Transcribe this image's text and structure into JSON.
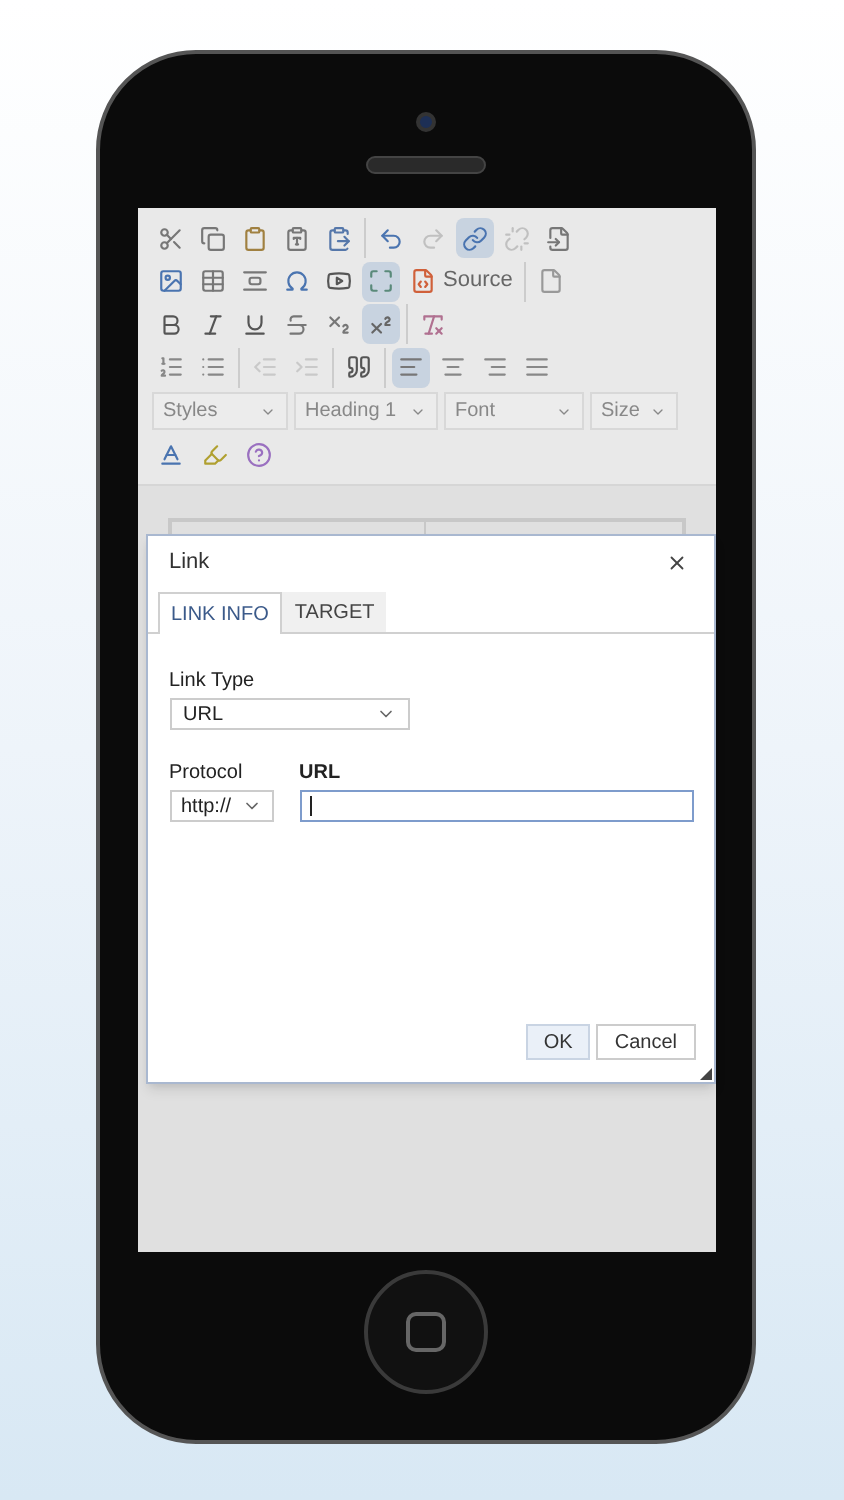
{
  "toolbar": {
    "rows": [
      {
        "groups": [
          [
            {
              "kind": "cut",
              "selected": false,
              "disabled": false
            },
            {
              "kind": "copy",
              "selected": false,
              "disabled": false
            },
            {
              "kind": "paste",
              "selected": false,
              "disabled": false
            },
            {
              "kind": "paste-text",
              "selected": false,
              "disabled": false
            },
            {
              "kind": "paste-word",
              "selected": false,
              "disabled": false
            }
          ],
          [
            {
              "kind": "undo",
              "selected": false,
              "disabled": false
            },
            {
              "kind": "redo",
              "selected": false,
              "disabled": true
            },
            {
              "kind": "link",
              "selected": true,
              "disabled": false
            },
            {
              "kind": "unlink",
              "selected": false,
              "disabled": true
            },
            {
              "kind": "anchor",
              "selected": false,
              "disabled": false
            }
          ]
        ]
      },
      {
        "groups": [
          [
            {
              "kind": "image",
              "selected": false,
              "disabled": false
            },
            {
              "kind": "table",
              "selected": false,
              "disabled": false
            },
            {
              "kind": "hline",
              "selected": false,
              "disabled": false
            },
            {
              "kind": "special-char",
              "selected": false,
              "disabled": false
            },
            {
              "kind": "video",
              "selected": false,
              "disabled": false
            },
            {
              "kind": "maximize",
              "selected": true,
              "disabled": false
            },
            {
              "kind": "source",
              "label": "Source",
              "selected": false,
              "disabled": false
            }
          ],
          [
            {
              "kind": "new-page",
              "selected": false,
              "disabled": false
            }
          ]
        ]
      },
      {
        "groups": [
          [
            {
              "kind": "bold",
              "selected": false,
              "disabled": false
            },
            {
              "kind": "italic",
              "selected": false,
              "disabled": false
            },
            {
              "kind": "underline",
              "selected": false,
              "disabled": false
            },
            {
              "kind": "strike",
              "selected": false,
              "disabled": false
            },
            {
              "kind": "subscript",
              "selected": false,
              "disabled": false
            },
            {
              "kind": "superscript",
              "selected": true,
              "disabled": false
            }
          ],
          [
            {
              "kind": "remove-format",
              "selected": false,
              "disabled": false
            }
          ]
        ]
      },
      {
        "groups": [
          [
            {
              "kind": "numbered-list",
              "selected": false,
              "disabled": false
            },
            {
              "kind": "bulleted-list",
              "selected": false,
              "disabled": false
            }
          ],
          [
            {
              "kind": "outdent",
              "selected": false,
              "disabled": true
            },
            {
              "kind": "indent",
              "selected": false,
              "disabled": true
            }
          ],
          [
            {
              "kind": "blockquote",
              "selected": false,
              "disabled": false
            }
          ],
          [
            {
              "kind": "align-left",
              "selected": true,
              "disabled": false
            },
            {
              "kind": "align-center",
              "selected": false,
              "disabled": false
            },
            {
              "kind": "align-right",
              "selected": false,
              "disabled": false
            },
            {
              "kind": "align-justify",
              "selected": false,
              "disabled": false
            }
          ]
        ]
      }
    ],
    "combos": [
      {
        "label": "Styles"
      },
      {
        "label": "Heading 1"
      },
      {
        "label": "Font"
      },
      {
        "label": "Size"
      }
    ],
    "last_row": [
      {
        "kind": "text-color",
        "selected": false,
        "disabled": false
      },
      {
        "kind": "bg-color",
        "selected": false,
        "disabled": false
      },
      {
        "kind": "help",
        "selected": false,
        "disabled": false
      }
    ]
  },
  "dialog": {
    "title": "Link",
    "tabs": [
      {
        "label": "LINK INFO",
        "selected": true
      },
      {
        "label": "TARGET",
        "selected": false
      }
    ],
    "link_type": {
      "label": "Link Type",
      "value": "URL"
    },
    "protocol": {
      "label": "Protocol",
      "value": "http://"
    },
    "url": {
      "label": "URL",
      "focused": true
    },
    "buttons": [
      {
        "label": "OK",
        "kind": "primary"
      },
      {
        "label": "Cancel",
        "kind": "secondary"
      }
    ]
  }
}
